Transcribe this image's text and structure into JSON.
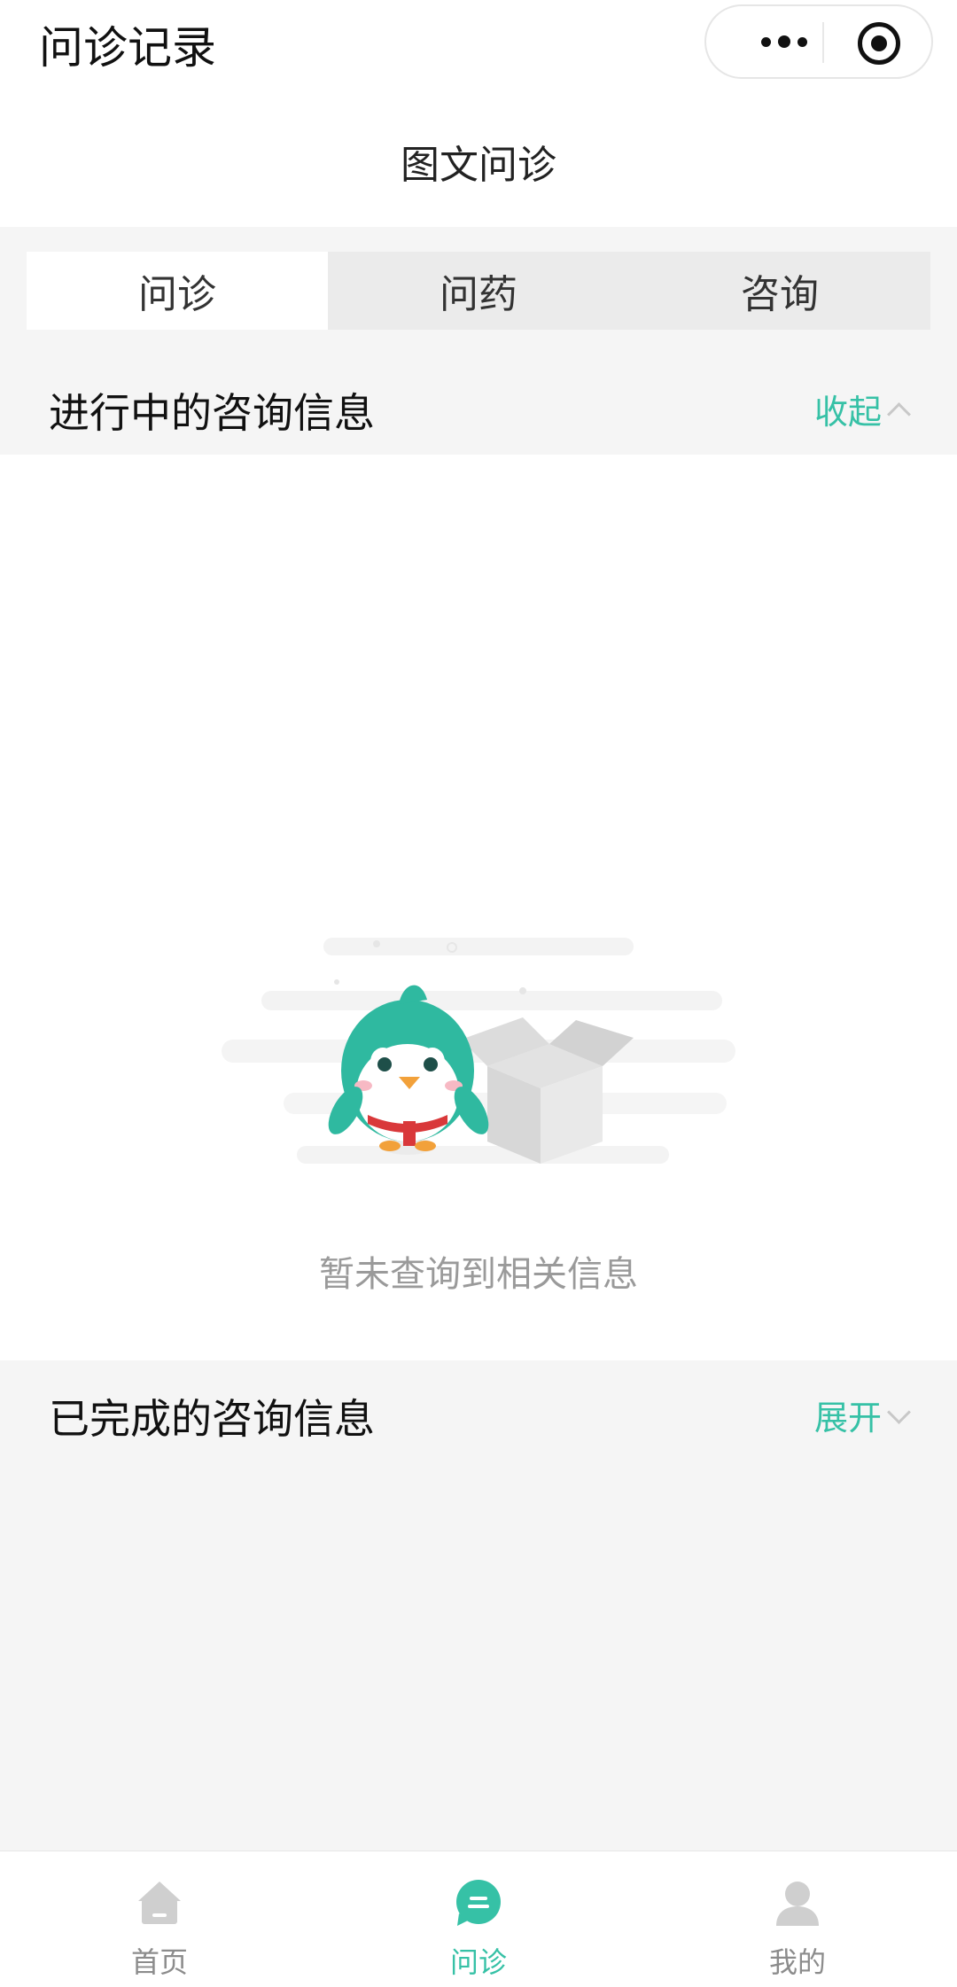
{
  "topbar": {
    "title": "问诊记录"
  },
  "subheader": {
    "title": "图文问诊"
  },
  "tabs": [
    {
      "label": "问诊",
      "active": true
    },
    {
      "label": "问药",
      "active": false
    },
    {
      "label": "咨询",
      "active": false
    }
  ],
  "ongoing": {
    "label": "进行中的咨询信息",
    "toggle_label": "收起"
  },
  "empty": {
    "message": "暂未查询到相关信息"
  },
  "completed": {
    "label": "已完成的咨询信息",
    "toggle_label": "展开"
  },
  "bottom_nav": [
    {
      "label": "首页",
      "icon": "home-icon",
      "active": false
    },
    {
      "label": "问诊",
      "icon": "chat-icon",
      "active": true
    },
    {
      "label": "我的",
      "icon": "user-icon",
      "active": false
    }
  ],
  "colors": {
    "accent": "#36c1a6",
    "inactive": "#cfcfcf",
    "background": "#f5f5f5"
  }
}
